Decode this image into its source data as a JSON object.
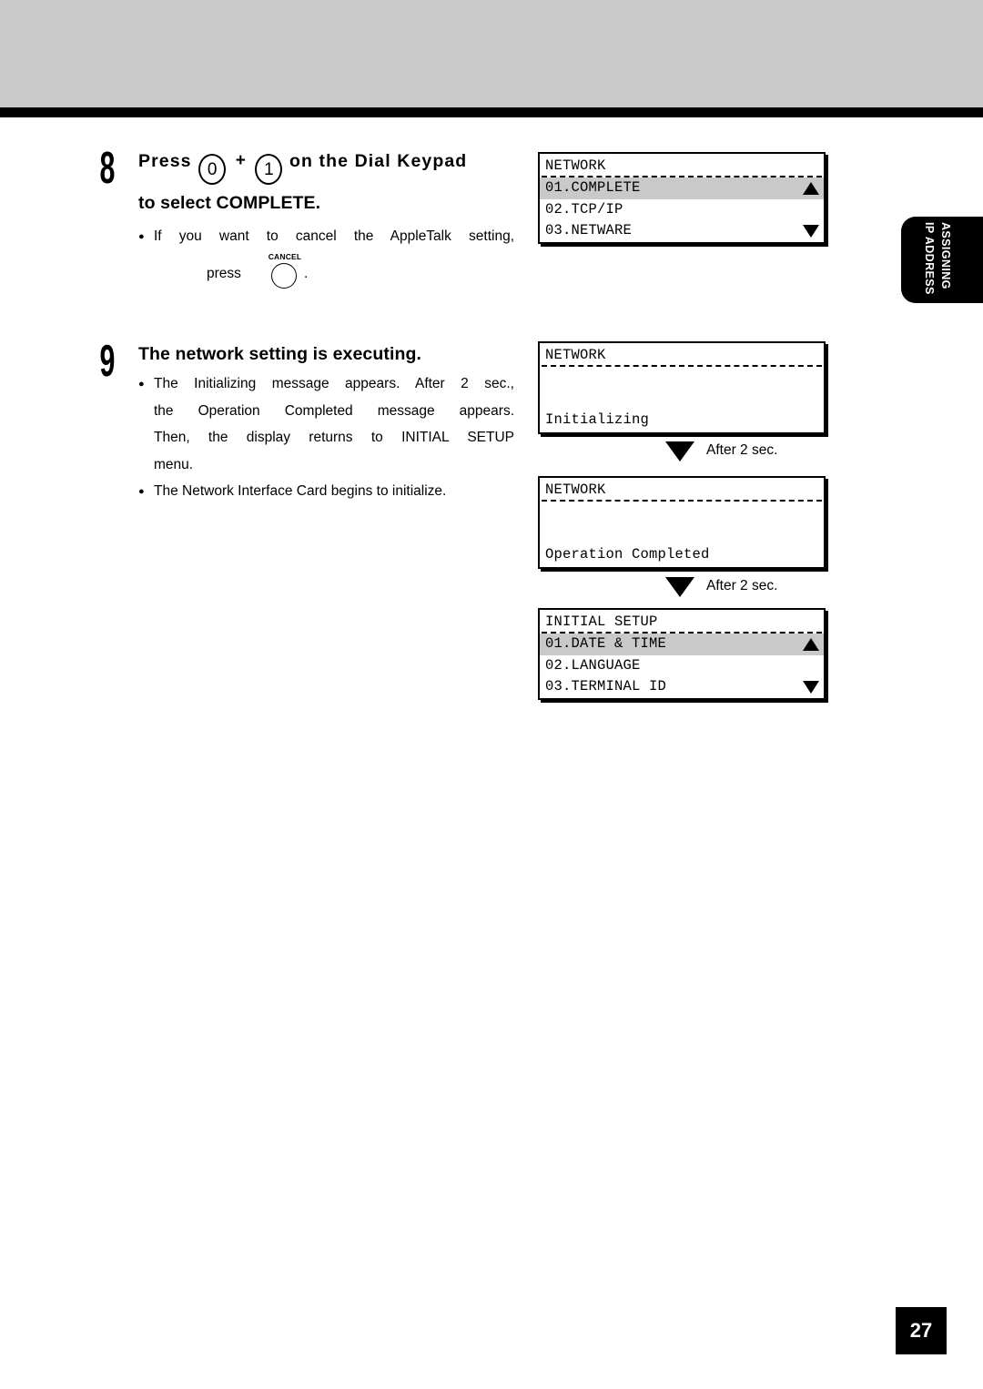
{
  "side_tab": {
    "line1": "ASSIGNING",
    "line2": "IP ADDRESS"
  },
  "steps": [
    {
      "number": "8",
      "title_before": "Press",
      "key1": "0",
      "plus": "+",
      "key2": "1",
      "title_after": "on the Dial Keypad",
      "title_line2": "to select COMPLETE.",
      "bullet1": "If you want to cancel the AppleTalk setting,",
      "press_word": "press",
      "cancel_label": "CANCEL",
      "period": "."
    },
    {
      "number": "9",
      "title": "The network setting is executing.",
      "bullet1_l1": "The Initializing message appears.  After 2 sec.,",
      "bullet1_l2": "the Operation Completed message appears.",
      "bullet1_l3": "Then, the display returns to INITIAL SETUP",
      "bullet1_l4": "menu.",
      "bullet2": "The Network Interface Card begins to initialize."
    }
  ],
  "lcd_panels": [
    {
      "title": "NETWORK",
      "rows": [
        {
          "text": "01.COMPLETE",
          "selected": true,
          "arrow": "up"
        },
        {
          "text": "02.TCP/IP",
          "selected": false,
          "arrow": "none"
        },
        {
          "text": "03.NETWARE",
          "selected": false,
          "arrow": "down"
        }
      ]
    },
    {
      "title": "NETWORK",
      "message": "Initializing"
    },
    {
      "title": "NETWORK",
      "message": "Operation Completed"
    },
    {
      "title": "INITIAL SETUP",
      "rows": [
        {
          "text": "01.DATE & TIME",
          "selected": true,
          "arrow": "up"
        },
        {
          "text": "02.LANGUAGE",
          "selected": false,
          "arrow": "none"
        },
        {
          "text": "03.TERMINAL ID",
          "selected": false,
          "arrow": "down"
        }
      ]
    }
  ],
  "after_markers": [
    {
      "text": "After 2 sec."
    },
    {
      "text": "After 2 sec."
    }
  ],
  "page_number": "27",
  "colors": {
    "band_gray": "#c9c9c9",
    "highlight_gray": "#c9c9c9",
    "ink": "#000000"
  }
}
